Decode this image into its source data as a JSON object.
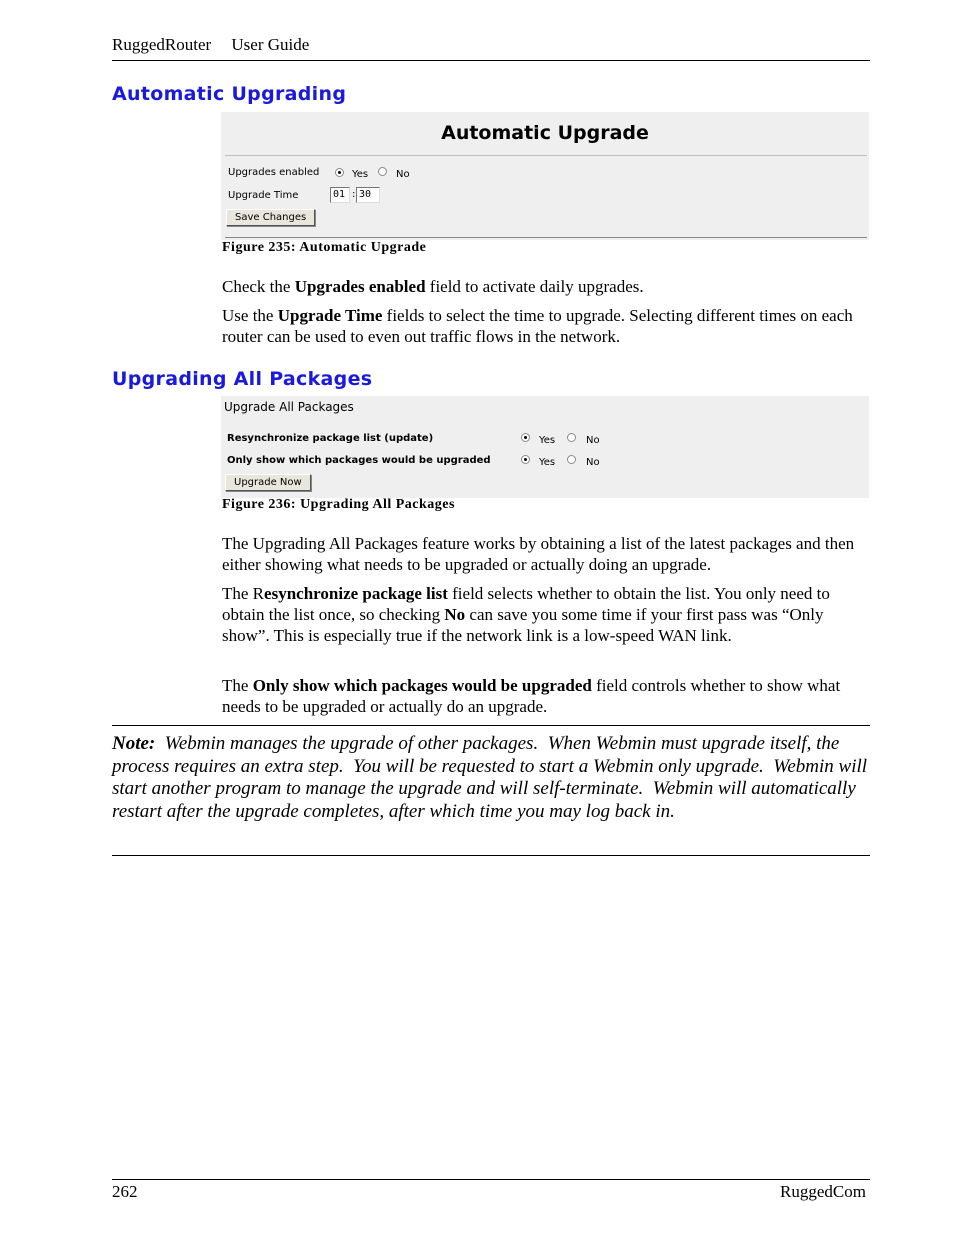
{
  "header": {
    "product": "RuggedRouter",
    "doc": "User Guide"
  },
  "sections": [
    {
      "heading": "Automatic Upgrading",
      "figure": {
        "panel_title": "Automatic Upgrade",
        "upgrades_enabled_label": "Upgrades enabled",
        "yes_label": "Yes",
        "no_label": "No",
        "upgrades_enabled_value": "Yes",
        "upgrade_time_label": "Upgrade Time",
        "hour_value": "01",
        "separator": ":",
        "minute_value": "30",
        "save_button": "Save Changes",
        "caption": "Figure 235: Automatic Upgrade"
      },
      "paragraphs": [
        {
          "pre": "Check the ",
          "bold": "Upgrades enabled",
          "post": " field to activate daily upgrades."
        },
        {
          "pre": "Use the ",
          "bold": "Upgrade Time",
          "post": " fields to select the time to upgrade.  Selecting different times on each router can be used to even out traffic flows in the network."
        }
      ]
    },
    {
      "heading": "Upgrading All Packages",
      "figure": {
        "panel_title": "Upgrade All Packages",
        "resync_label": "Resynchronize package list (update)",
        "only_show_label": "Only show which packages would be upgraded",
        "yes_label": "Yes",
        "no_label": "No",
        "resync_value": "Yes",
        "only_show_value": "Yes",
        "upgrade_button": "Upgrade Now",
        "caption": "Figure 236: Upgrading All Packages"
      },
      "paragraphs": [
        {
          "pre": "The Upgrading All Packages feature works by obtaining a list of the latest packages and then either showing what needs to be upgraded or actually doing an upgrade.",
          "bold": "",
          "post": ""
        },
        {
          "pre": "The R",
          "bold": "esynchronize package list",
          "post": " field selects whether to obtain the list.  You only need to obtain the list once, so checking ",
          "bold2": "No",
          "post2": " can save you some time if your first pass was  “Only show”.  This is especially true if the network link is a low-speed WAN link."
        },
        {
          "pre": "The ",
          "bold": "Only show which packages would be upgraded",
          "post": " field controls whether to show what needs to be upgraded or actually do an upgrade."
        }
      ]
    }
  ],
  "note": {
    "label": "Note:",
    "text": "  Webmin manages the upgrade of other packages.  When Webmin must upgrade itself, the process requires an extra step.  You will be requested to start a Webmin only upgrade.  Webmin will start another program to manage the upgrade and will self-terminate.  Webmin will automatically restart after the upgrade completes, after which time you may log back in."
  },
  "footer": {
    "page_number": "262",
    "brand": "RuggedCom"
  }
}
